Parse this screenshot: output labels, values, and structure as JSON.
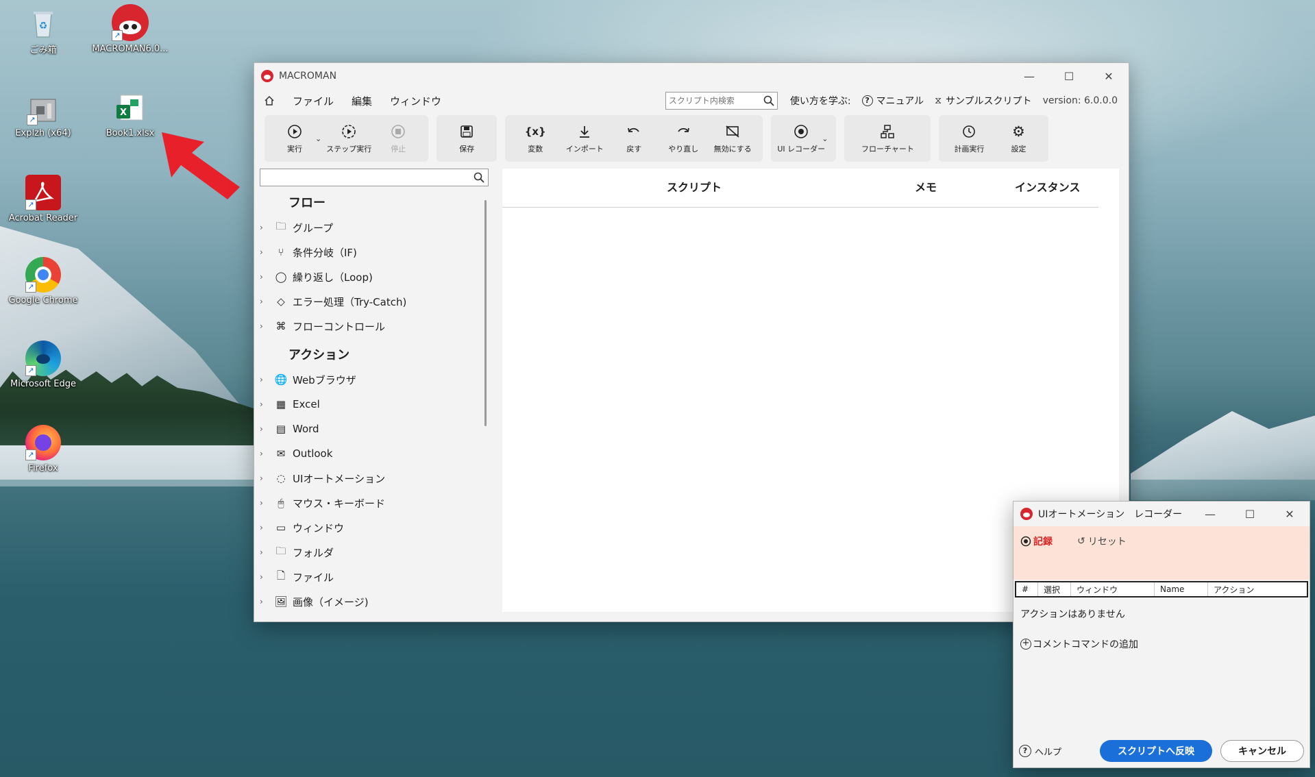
{
  "desktop": {
    "icons": [
      {
        "label": "ごみ箱",
        "icon": "recycle-bin-icon"
      },
      {
        "label": "MACROMAN6.0...",
        "icon": "macroman-icon"
      },
      {
        "label": "Explzh (x64)",
        "icon": "explzh-icon"
      },
      {
        "label": "Book1.xlsx",
        "icon": "excel-file-icon"
      },
      {
        "label": "Acrobat Reader",
        "icon": "acrobat-icon"
      },
      {
        "label": "Google Chrome",
        "icon": "chrome-icon"
      },
      {
        "label": "Microsoft Edge",
        "icon": "edge-icon"
      },
      {
        "label": "Firefox",
        "icon": "firefox-icon"
      }
    ]
  },
  "main_window": {
    "title": "MACROMAN",
    "menu": {
      "file": "ファイル",
      "edit": "編集",
      "window": "ウィンドウ"
    },
    "search_placeholder": "スクリプト内検索",
    "learn_label": "使い方を学ぶ:",
    "manual_label": "マニュアル",
    "sample_label": "サンプルスクリプト",
    "version": "version: 6.0.0.0",
    "toolbar": {
      "run": "実行",
      "step_run": "ステップ実行",
      "stop": "停止",
      "save": "保存",
      "variables": "変数",
      "import": "インポート",
      "undo": "戻す",
      "redo": "やり直し",
      "disable": "無効にする",
      "ui_recorder": "UI レコーダー",
      "flowchart": "フローチャート",
      "schedule": "計画実行",
      "settings": "設定"
    },
    "tree": {
      "flow_heading": "フロー",
      "flow_items": [
        "グループ",
        "条件分岐（IF)",
        "繰り返し（Loop)",
        "エラー処理（Try-Catch)",
        "フローコントロール"
      ],
      "action_heading": "アクション",
      "action_items": [
        "Webブラウザ",
        "Excel",
        "Word",
        "Outlook",
        "UIオートメーション",
        "マウス・キーボード",
        "ウィンドウ",
        "フォルダ",
        "ファイル",
        "画像（イメージ)"
      ]
    },
    "columns": {
      "script": "スクリプト",
      "memo": "メモ",
      "instance": "インスタンス"
    }
  },
  "recorder": {
    "title": "UIオートメーション　レコーダー",
    "record": "記録",
    "reset": "リセット",
    "columns": [
      "#",
      "選択",
      "ウィンドウ",
      "Name",
      "アクション"
    ],
    "empty_text": "アクションはありません",
    "add_comment": "コメントコマンドの追加",
    "help": "ヘルプ",
    "apply": "スクリプトへ反映",
    "cancel": "キャンセル"
  },
  "colors": {
    "accent_blue": "#1a6fd8",
    "record_red": "#dd2222",
    "recorder_toolbar_bg": "#fde3d7",
    "arrow_red": "#e8202a"
  }
}
